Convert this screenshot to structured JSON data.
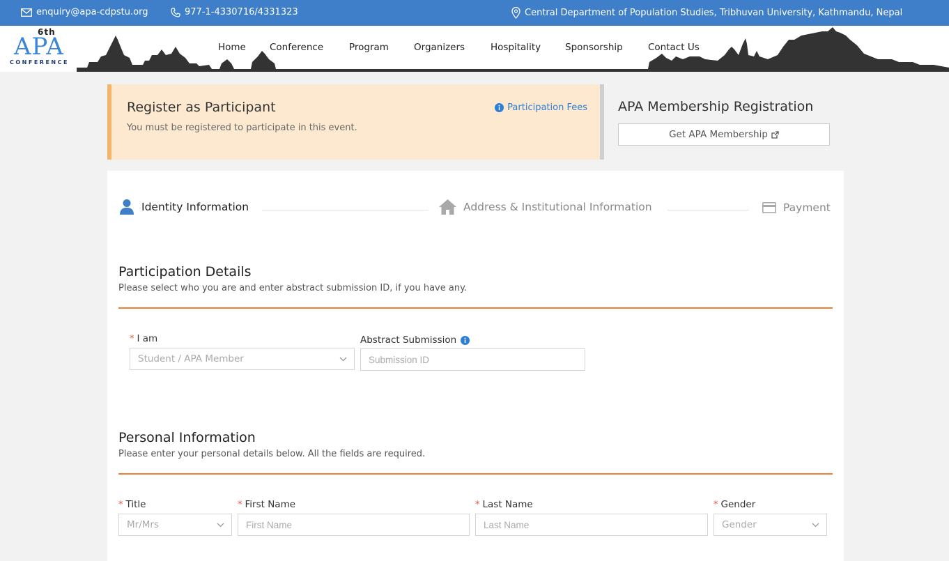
{
  "topbar": {
    "email": "enquiry@apa-cdpstu.org",
    "phone": "977-1-4330716/4331323",
    "address": "Central Department of Population Studies, Tribhuvan University, Kathmandu, Nepal"
  },
  "logo": {
    "sup": "6th",
    "name": "APA",
    "tag": "CONFERENCE"
  },
  "nav": [
    "Home",
    "Conference",
    "Program",
    "Organizers",
    "Hospitality",
    "Sponsorship",
    "Contact Us"
  ],
  "alert": {
    "title": "Register as Participant",
    "subtitle": "You must be registered to participate in this event.",
    "fees_link": "Participation Fees"
  },
  "membership": {
    "title": "APA Membership Registration",
    "button": "Get APA Membership"
  },
  "steps": [
    "Identity Information",
    "Address & Institutional Information",
    "Payment"
  ],
  "participation": {
    "title": "Participation Details",
    "subtitle": "Please select who you are and enter abstract submission ID, if you have any.",
    "iam_label": "I am",
    "iam_placeholder": "Student / APA Member",
    "abstract_label": "Abstract Submission",
    "abstract_placeholder": "Submission ID"
  },
  "personal": {
    "title": "Personal Information",
    "subtitle": "Please enter your personal details below. All the fields are required.",
    "title_label": "Title",
    "title_placeholder": "Mr/Mrs",
    "first_label": "First Name",
    "first_placeholder": "First Name",
    "last_label": "Last Name",
    "last_placeholder": "Last Name",
    "gender_label": "Gender",
    "gender_placeholder": "Gender"
  },
  "colors": {
    "brand_blue": "#3f7fca",
    "accent_orange": "#ee7f33",
    "alert_bg": "#fde9cf",
    "required": "#e5553d"
  }
}
